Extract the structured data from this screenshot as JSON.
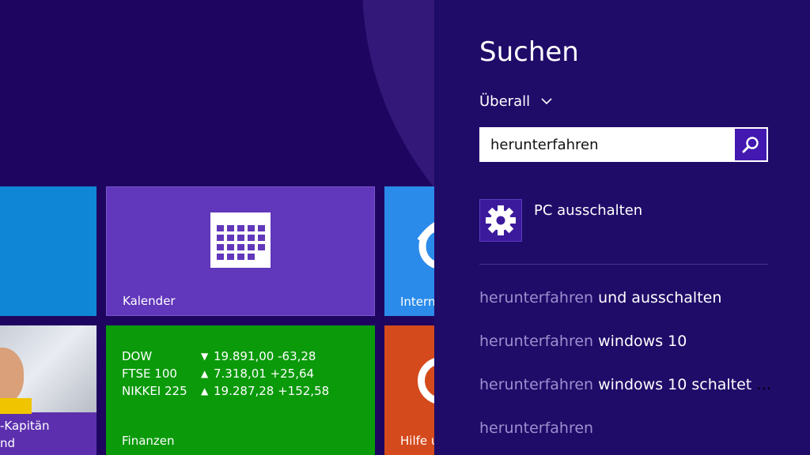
{
  "start": {
    "tiles": {
      "kalender": {
        "label": "Kalender"
      },
      "ie": {
        "label": "Intern"
      },
      "people": {
        "line1": "-Kapitän",
        "line2": "nd"
      },
      "finanzen": {
        "label": "Finanzen",
        "rows": [
          {
            "name": "DOW",
            "trend": "down",
            "arrow": "▼",
            "value": "19.891,00 -63,28"
          },
          {
            "name": "FTSE 100",
            "trend": "up",
            "arrow": "▲",
            "value": "7.318,01 +25,64"
          },
          {
            "name": "NIKKEI 225",
            "trend": "up",
            "arrow": "▲",
            "value": "19.287,28 +152,58"
          }
        ]
      },
      "hilfe": {
        "label": "Hilfe u"
      }
    }
  },
  "search": {
    "title": "Suchen",
    "scope": "Überall",
    "query": "herunterfahren",
    "result": {
      "label": "PC ausschalten",
      "icon": "gear-icon"
    },
    "suggestions": [
      {
        "match": "herunterfahren",
        "rest": " und ausschalten"
      },
      {
        "match": "herunterfahren",
        "rest": " windows 10"
      },
      {
        "match": "herunterfahren",
        "rest": " windows 10 schaltet nich..."
      },
      {
        "match": "herunterfahren",
        "rest": ""
      }
    ]
  },
  "colors": {
    "background": "#1d0660",
    "pane": "#1f0b68",
    "kalender_tile": "#6137bb",
    "finanzen_tile": "#0a9a0a",
    "accent": "#4218b0"
  }
}
